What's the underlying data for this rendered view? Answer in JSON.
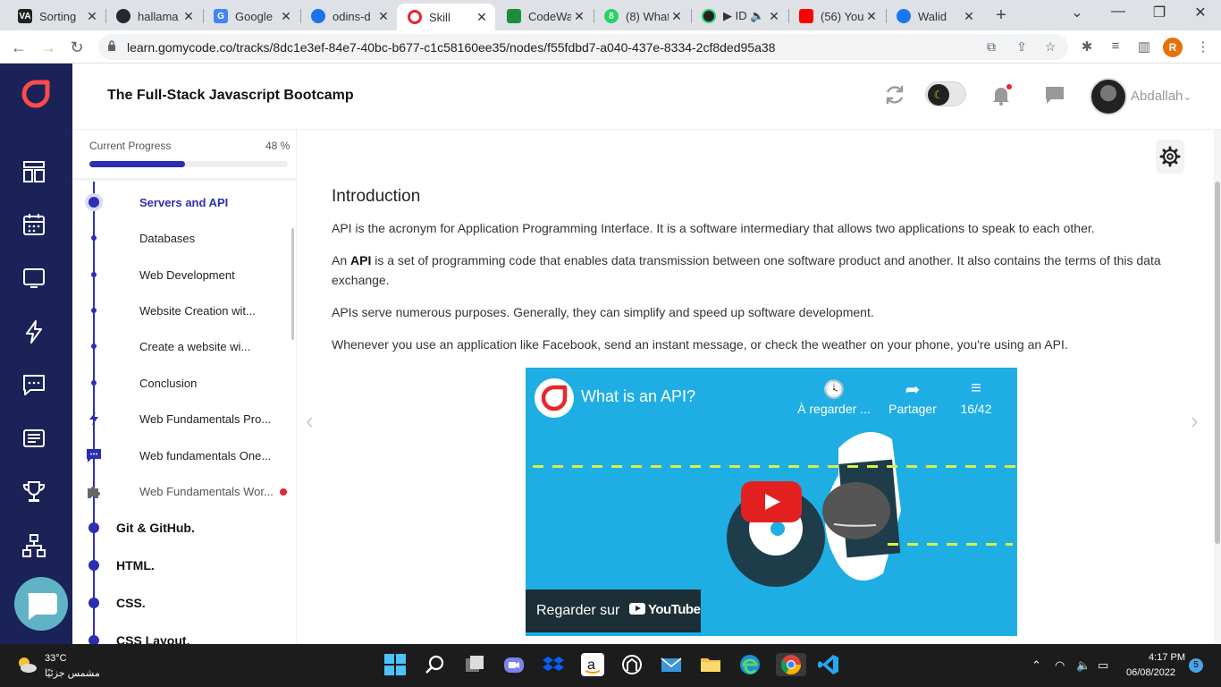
{
  "browser": {
    "tabs": [
      {
        "title": "Sorting",
        "favicon_text": "VA",
        "favicon_color": "#222222"
      },
      {
        "title": "hallama",
        "favicon_text": "",
        "favicon_color": "#24292f"
      },
      {
        "title": "Google",
        "favicon_text": "G",
        "favicon_color": "#4285f4"
      },
      {
        "title": "odins-d",
        "favicon_text": "",
        "favicon_color": "#1a73e8"
      },
      {
        "title": "Skill",
        "favicon_text": "",
        "favicon_color": "#e8262d"
      },
      {
        "title": "CodeWa",
        "favicon_text": "",
        "favicon_color": "#1e8e3e"
      },
      {
        "title": "(8) What",
        "favicon_text": "8",
        "favicon_color": "#25d366"
      },
      {
        "title": "ID",
        "favicon_text": "",
        "favicon_color": "#222222"
      },
      {
        "title": "(56) You",
        "favicon_text": "",
        "favicon_color": "#ff0000"
      },
      {
        "title": "Walid",
        "favicon_text": "",
        "favicon_color": "#1877f2"
      }
    ],
    "url": "learn.gomycode.co/tracks/8dc1e3ef-84e7-40bc-b677-c1c58160ee35/nodes/f55fdbd7-a040-437e-8334-2cf8ded95a38",
    "profile_initial": "R"
  },
  "header": {
    "title": "The Full-Stack Javascript Bootcamp",
    "username": "Abdallah"
  },
  "progress": {
    "label": "Current Progress",
    "percent_text": "48 %",
    "percent": 48
  },
  "sidebar": {
    "items": [
      {
        "label": "Servers and API",
        "active": true
      },
      {
        "label": "Databases"
      },
      {
        "label": "Web Development"
      },
      {
        "label": "Website Creation wit..."
      },
      {
        "label": "Create a website wi..."
      },
      {
        "label": "Conclusion"
      },
      {
        "label": "Web Fundamentals Pro...",
        "icon": "lightning-icon"
      },
      {
        "label": "Web fundamentals One...",
        "icon": "chat-icon"
      },
      {
        "label": "Web Fundamentals Wor...",
        "icon": "puzzle-icon",
        "unread": true
      }
    ],
    "sections": [
      "Git & GitHub.",
      "HTML.",
      "CSS.",
      "CSS Layout."
    ]
  },
  "content": {
    "heading": "Introduction",
    "p1": "API is the acronym for Application Programming Interface. It is a software intermediary that allows two applications to speak to each other.",
    "p2_pre": "An ",
    "p2_bold": "API",
    "p2_post": " is a set of programming code that enables data transmission between one software product and another. It also contains the terms of this data exchange.",
    "p3": "APIs serve numerous purposes. Generally, they can simplify and speed up software development.",
    "p4": "Whenever you use an application like Facebook, send an instant message, or check the weather on your phone, you're using an API."
  },
  "video": {
    "title": "What is an API?",
    "watch_later": "À regarder ...",
    "share": "Partager",
    "playlist": "16/42",
    "watch_on": "Regarder sur",
    "youtube": "YouTube"
  },
  "taskbar": {
    "temperature": "33°C",
    "weather_desc": "مشمس جزئيًا",
    "time": "4:17 PM",
    "date": "06/08/2022",
    "notifications": "5"
  },
  "colors": {
    "rail": "#1a2257",
    "accent": "#2b2fb3",
    "brand_red": "#e8262d",
    "video_bg": "#1eaee4"
  }
}
